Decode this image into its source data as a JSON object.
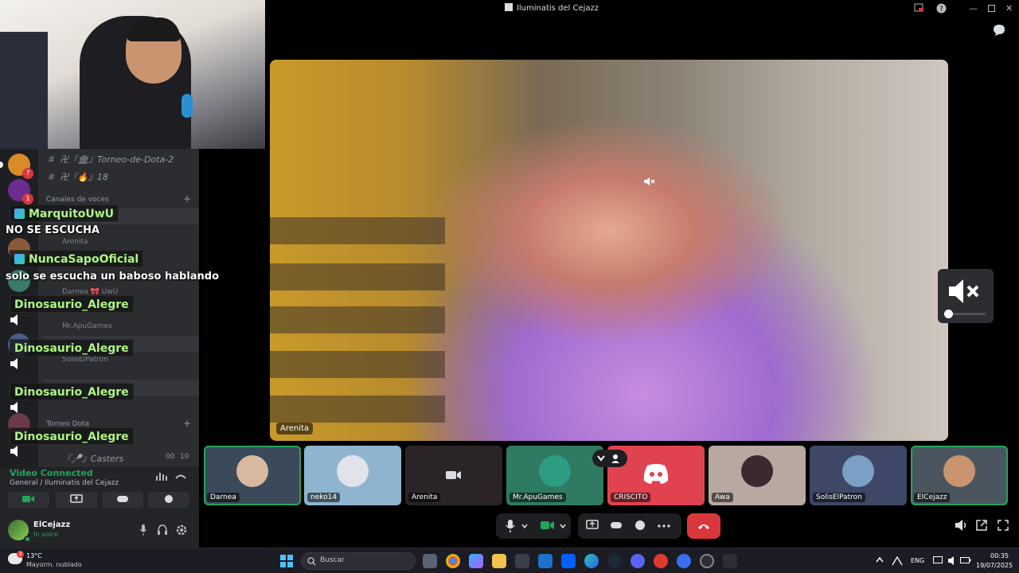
{
  "call": {
    "title": "Iluminatis del Cejazz",
    "main_video_name": "Arenita"
  },
  "sidebar": {
    "channels": [
      {
        "name": "卍『🏛』Torneo-de-Dota-2"
      },
      {
        "name": "卍『🔥』18"
      }
    ],
    "voice_category": "Canales de voces",
    "voice_users": [
      "Arenita",
      "Darnea 🎀 UwU",
      "Mr.ApuGames",
      "SolisElPatron"
    ],
    "second_category": "Torneo Dota",
    "casters_channel": "『🎤』Casters",
    "casters_counts": [
      "00",
      "10"
    ],
    "servers": [
      {
        "badge": "7"
      },
      {
        "badge": "1"
      }
    ]
  },
  "chat": [
    {
      "type": "name",
      "text": "MarquitoUwU"
    },
    {
      "type": "msg",
      "text": "NO SE ESCUCHA"
    },
    {
      "type": "name",
      "text": "NuncaSapoOficial"
    },
    {
      "type": "msg",
      "text": "solo se escucha un baboso hablando"
    },
    {
      "type": "name",
      "text": "Dinosaurio_Alegre"
    },
    {
      "type": "name",
      "text": "Dinosaurio_Alegre"
    },
    {
      "type": "name",
      "text": "Dinosaurio_Alegre"
    },
    {
      "type": "name",
      "text": "Dinosaurio_Alegre"
    }
  ],
  "voice_panel": {
    "status": "Video Connected",
    "location": "General / Iluminatis del Cejazz"
  },
  "user": {
    "name": "ElCejazz",
    "status": "In voice"
  },
  "participants": [
    {
      "name": "Darnea",
      "color": "#3a4a5a"
    },
    {
      "name": "neko14",
      "color": "#8fb4cf"
    },
    {
      "name": "Arenita",
      "color": "#2a2426"
    },
    {
      "name": "Mr.ApuGames",
      "color": "#2f7a62"
    },
    {
      "name": "CRISCITO",
      "color": "#e0434f"
    },
    {
      "name": "Awa",
      "color": "#b8a8a0"
    },
    {
      "name": "SolisElPatron",
      "color": "#3e4766"
    },
    {
      "name": "ElCejazz",
      "color": "#4a5560"
    }
  ],
  "taskbar": {
    "weather_temp": "13°C",
    "weather_desc": "Mayorm. nublado",
    "weather_badge": "3",
    "search_placeholder": "Buscar",
    "language": "ENG",
    "time": "00:35",
    "date": "19/07/2025"
  },
  "colors": {
    "discord_green": "#23a55a",
    "hangup_red": "#da373c",
    "chat_name_green": "#aef585"
  }
}
